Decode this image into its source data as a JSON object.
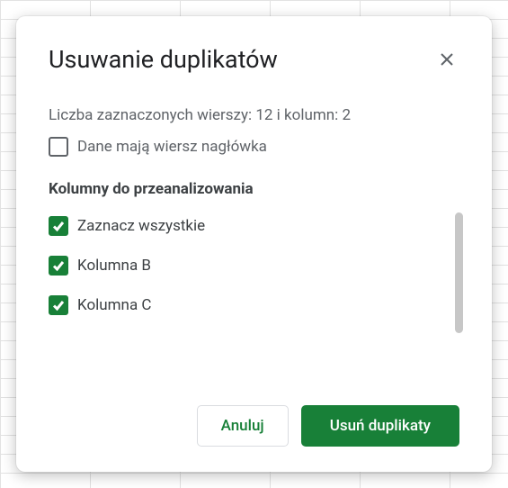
{
  "dialog": {
    "title": "Usuwanie duplikatów",
    "info": "Liczba zaznaczonych wierszy: 12 i kolumn: 2",
    "header_checkbox_label": "Dane mają wiersz nagłówka",
    "columns_section_title": "Kolumny do przeanalizowania",
    "select_all_label": "Zaznacz wszystkie",
    "columns": [
      {
        "label": "Kolumna B"
      },
      {
        "label": "Kolumna C"
      }
    ],
    "cancel_label": "Anuluj",
    "primary_label": "Usuń duplikaty"
  }
}
